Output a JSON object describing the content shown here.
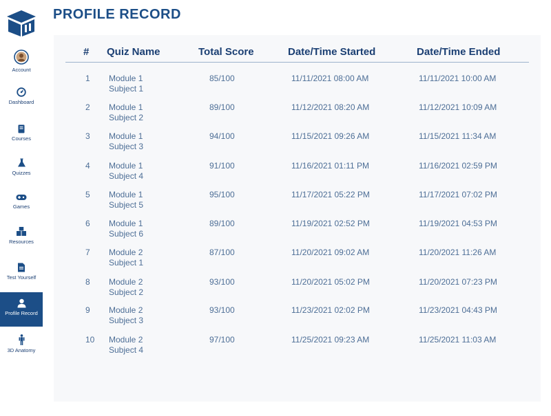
{
  "page_title": "PROFILE RECORD",
  "sidebar": {
    "items": [
      {
        "label": "Account",
        "icon": "avatar"
      },
      {
        "label": "Dashboard",
        "icon": "gauge-icon"
      },
      {
        "label": "Courses",
        "icon": "book-icon"
      },
      {
        "label": "Quizzes",
        "icon": "flask-icon"
      },
      {
        "label": "Games",
        "icon": "gamepad-icon"
      },
      {
        "label": "Resources",
        "icon": "boxes-icon"
      },
      {
        "label": "Test Yourself",
        "icon": "clipboard-icon"
      },
      {
        "label": "Profile Record",
        "icon": "user-icon",
        "active": true
      },
      {
        "label": "3D Anatomy",
        "icon": "figure-icon"
      }
    ]
  },
  "table": {
    "headers": [
      "#",
      "Quiz Name",
      "Total Score",
      "Date/Time Started",
      "Date/Time Ended"
    ],
    "rows": [
      {
        "num": "1",
        "module": "Module 1",
        "subject": "Subject 1",
        "score": "85/100",
        "started": "11/11/2021 08:00 AM",
        "ended": "11/11/2021 10:00 AM"
      },
      {
        "num": "2",
        "module": "Module 1",
        "subject": "Subject 2",
        "score": "89/100",
        "started": "11/12/2021 08:20 AM",
        "ended": "11/12/2021 10:09 AM"
      },
      {
        "num": "3",
        "module": "Module 1",
        "subject": "Subject 3",
        "score": "94/100",
        "started": "11/15/2021 09:26 AM",
        "ended": "11/15/2021 11:34 AM"
      },
      {
        "num": "4",
        "module": "Module 1",
        "subject": "Subject 4",
        "score": "91/100",
        "started": "11/16/2021 01:11 PM",
        "ended": "11/16/2021 02:59 PM"
      },
      {
        "num": "5",
        "module": "Module 1",
        "subject": "Subject 5",
        "score": "95/100",
        "started": "11/17/2021 05:22 PM",
        "ended": "11/17/2021 07:02 PM"
      },
      {
        "num": "6",
        "module": "Module 1",
        "subject": "Subject 6",
        "score": "89/100",
        "started": "11/19/2021 02:52 PM",
        "ended": "11/19/2021 04:53 PM"
      },
      {
        "num": "7",
        "module": "Module 2",
        "subject": "Subject 1",
        "score": "87/100",
        "started": "11/20/2021 09:02 AM",
        "ended": "11/20/2021 11:26 AM"
      },
      {
        "num": "8",
        "module": "Module 2",
        "subject": "Subject 2",
        "score": "93/100",
        "started": "11/20/2021 05:02 PM",
        "ended": "11/20/2021 07:23 PM"
      },
      {
        "num": "9",
        "module": "Module 2",
        "subject": "Subject 3",
        "score": "93/100",
        "started": "11/23/2021 02:02 PM",
        "ended": "11/23/2021 04:43 PM"
      },
      {
        "num": "10",
        "module": "Module 2",
        "subject": "Subject 4",
        "score": "97/100",
        "started": "11/25/2021 09:23 AM",
        "ended": "11/25/2021 11:03 AM"
      }
    ]
  },
  "colors": {
    "primary": "#1c4e87",
    "text": "#1b3f73",
    "cell_text": "#4d6e96",
    "panel_bg": "#f7f8fa"
  }
}
